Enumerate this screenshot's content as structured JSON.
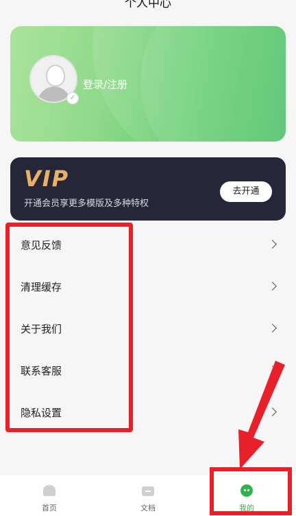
{
  "header": {
    "title": "个人中心"
  },
  "profile": {
    "login_label": "登录/注册"
  },
  "vip": {
    "logo": "VIP",
    "description": "开通会员享更多模版及多种特权",
    "button_label": "去开通"
  },
  "menu": {
    "items": [
      {
        "label": "意见反馈"
      },
      {
        "label": "清理缓存"
      },
      {
        "label": "关于我们"
      },
      {
        "label": "联系客服"
      },
      {
        "label": "隐私设置"
      }
    ]
  },
  "tabbar": {
    "tabs": [
      {
        "label": "首页",
        "icon": "home-icon"
      },
      {
        "label": "文档",
        "icon": "document-icon"
      },
      {
        "label": "我的",
        "icon": "profile-icon"
      }
    ],
    "active_index": 2,
    "active_color": "#2fb34a"
  },
  "annotation_color": "#e8202a"
}
